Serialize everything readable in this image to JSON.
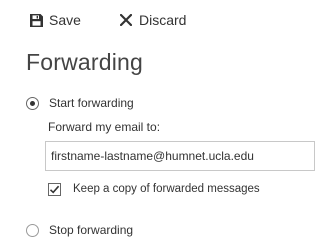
{
  "toolbar": {
    "save_label": "Save",
    "save_icon": "floppy-disk-icon",
    "discard_label": "Discard",
    "discard_icon": "close-x-icon"
  },
  "page": {
    "title": "Forwarding"
  },
  "forwarding": {
    "start_label": "Start forwarding",
    "start_selected": true,
    "forward_to_label": "Forward my email to:",
    "email_value": "firstname-lastname@humnet.ucla.edu",
    "keep_copy_label": "Keep a copy of forwarded messages",
    "keep_copy_checked": true,
    "stop_label": "Stop forwarding",
    "stop_selected": false
  },
  "colors": {
    "text": "#333333",
    "title": "#444444",
    "border": "#c8c8c8",
    "background": "#ffffff"
  }
}
